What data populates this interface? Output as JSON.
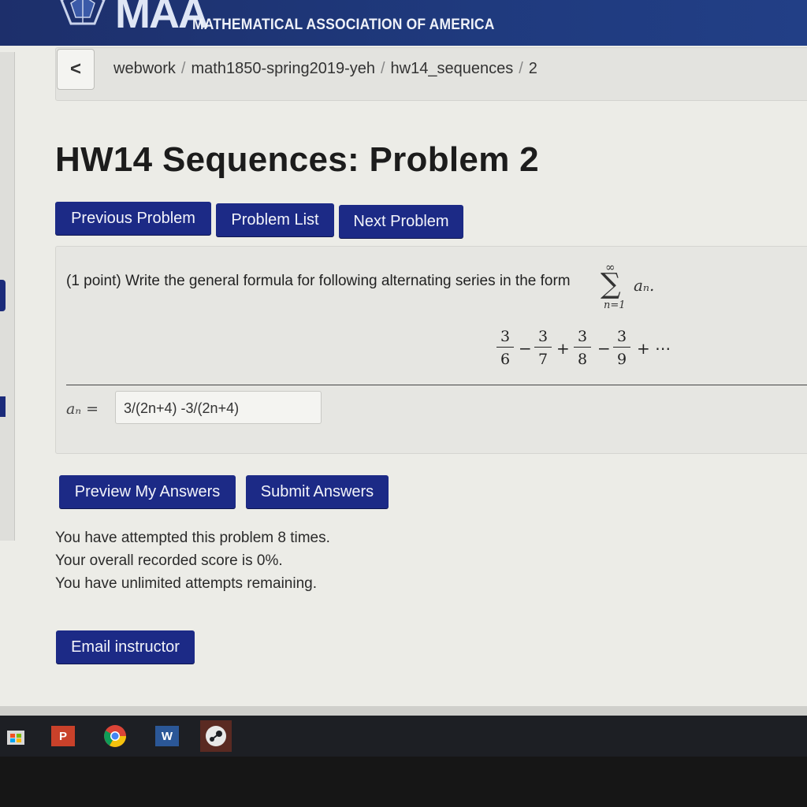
{
  "header": {
    "logo_text": "MAA",
    "org_name": "MATHEMATICAL ASSOCIATION OF AMERICA"
  },
  "breadcrumb": {
    "back_label": "<",
    "items": [
      "webwork",
      "math1850-spring2019-yeh",
      "hw14_sequences",
      "2"
    ]
  },
  "page": {
    "title": "HW14 Sequences: Problem 2"
  },
  "nav": {
    "previous": "Previous Problem",
    "list": "Problem List",
    "next": "Next Problem"
  },
  "problem": {
    "prompt": "(1 point) Write the general formula for following alternating series in the form",
    "sum_upper": "∞",
    "sum_sign": "∑",
    "sum_lower": "n=1",
    "sum_term": "aₙ.",
    "series": {
      "numerators": [
        "3",
        "3",
        "3",
        "3"
      ],
      "denominators": [
        "6",
        "7",
        "8",
        "9"
      ],
      "operators": [
        "−",
        "+",
        "−",
        "+ ⋯"
      ]
    },
    "answer_label": "aₙ =",
    "answer_value": "3/(2n+4) -3/(2n+4)"
  },
  "actions": {
    "preview": "Preview My Answers",
    "submit": "Submit Answers",
    "email": "Email instructor"
  },
  "status": {
    "attempts": "You have attempted this problem 8 times.",
    "score": "Your overall recorded score is 0%.",
    "remaining": "You have unlimited attempts remaining."
  },
  "taskbar": {
    "icons": [
      "store-icon",
      "powerpoint-icon",
      "chrome-icon",
      "word-icon",
      "steam-icon"
    ],
    "powerpoint_glyph": "P",
    "word_glyph": "W"
  },
  "colors": {
    "brand_blue": "#1c2a86",
    "banner": "#1f3a7e",
    "page_bg": "#ecece7"
  }
}
